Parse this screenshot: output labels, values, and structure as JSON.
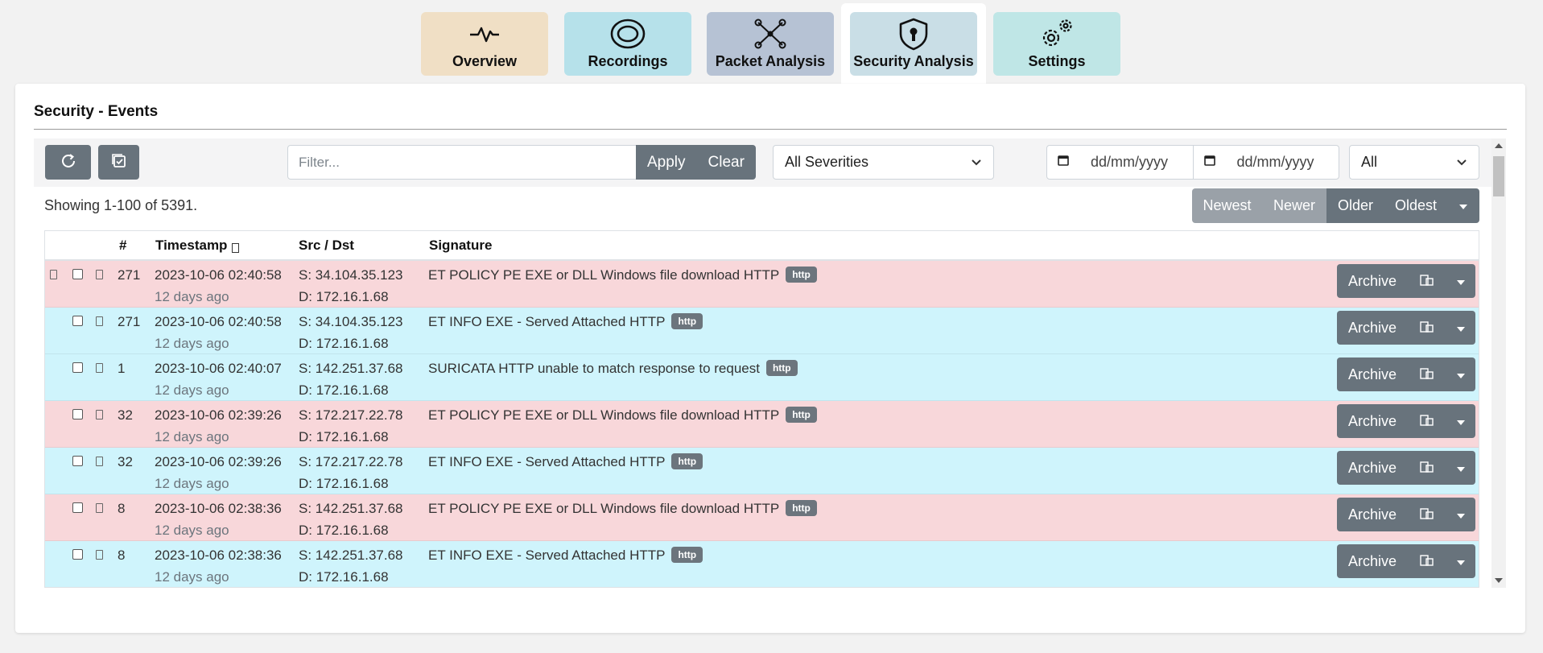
{
  "colors": {
    "overview_tab": "#f0dfc5",
    "recordings_tab": "#b6e1ea",
    "packet_tab": "#b6c2d4",
    "security_tab": "#c9dee6",
    "settings_tab": "#bfe6e6",
    "button": "#68737c",
    "row_danger": "#f8d7da",
    "row_info": "#cff4fc"
  },
  "tabs": [
    {
      "label": "Overview",
      "icon": "pulse-icon"
    },
    {
      "label": "Recordings",
      "icon": "recording-icon"
    },
    {
      "label": "Packet Analysis",
      "icon": "network-icon"
    },
    {
      "label": "Security Analysis",
      "icon": "shield-icon"
    },
    {
      "label": "Settings",
      "icon": "gears-icon"
    }
  ],
  "page": {
    "title": "Security - Events"
  },
  "toolbar": {
    "filter_placeholder": "Filter...",
    "apply_label": "Apply",
    "clear_label": "Clear",
    "severity_value": "All Severities",
    "date_from_placeholder": "dd/mm/yyyy",
    "date_to_placeholder": "dd/mm/yyyy",
    "scope_value": "All"
  },
  "showing_text": "Showing 1-100 of 5391.",
  "pager": {
    "newest": "Newest",
    "newer": "Newer",
    "older": "Older",
    "oldest": "Oldest"
  },
  "table": {
    "headers": {
      "count": "#",
      "timestamp": "Timestamp",
      "src_dst": "Src / Dst",
      "signature": "Signature"
    },
    "archive_label": "Archive",
    "rows": [
      {
        "severity": "danger",
        "count": "271",
        "timestamp": "2023-10-06 02:40:58",
        "ago": "12 days ago",
        "src": "S: 34.104.35.123",
        "dst": "D: 172.16.1.68",
        "signature": "ET POLICY PE EXE or DLL Windows file download HTTP",
        "proto": "http"
      },
      {
        "severity": "info",
        "count": "271",
        "timestamp": "2023-10-06 02:40:58",
        "ago": "12 days ago",
        "src": "S: 34.104.35.123",
        "dst": "D: 172.16.1.68",
        "signature": "ET INFO EXE - Served Attached HTTP",
        "proto": "http"
      },
      {
        "severity": "info",
        "count": "1",
        "timestamp": "2023-10-06 02:40:07",
        "ago": "12 days ago",
        "src": "S: 142.251.37.68",
        "dst": "D: 172.16.1.68",
        "signature": "SURICATA HTTP unable to match response to request",
        "proto": "http"
      },
      {
        "severity": "danger",
        "count": "32",
        "timestamp": "2023-10-06 02:39:26",
        "ago": "12 days ago",
        "src": "S: 172.217.22.78",
        "dst": "D: 172.16.1.68",
        "signature": "ET POLICY PE EXE or DLL Windows file download HTTP",
        "proto": "http"
      },
      {
        "severity": "info",
        "count": "32",
        "timestamp": "2023-10-06 02:39:26",
        "ago": "12 days ago",
        "src": "S: 172.217.22.78",
        "dst": "D: 172.16.1.68",
        "signature": "ET INFO EXE - Served Attached HTTP",
        "proto": "http"
      },
      {
        "severity": "danger",
        "count": "8",
        "timestamp": "2023-10-06 02:38:36",
        "ago": "12 days ago",
        "src": "S: 142.251.37.68",
        "dst": "D: 172.16.1.68",
        "signature": "ET POLICY PE EXE or DLL Windows file download HTTP",
        "proto": "http"
      },
      {
        "severity": "info",
        "count": "8",
        "timestamp": "2023-10-06 02:38:36",
        "ago": "12 days ago",
        "src": "S: 142.251.37.68",
        "dst": "D: 172.16.1.68",
        "signature": "ET INFO EXE - Served Attached HTTP",
        "proto": "http"
      }
    ]
  }
}
